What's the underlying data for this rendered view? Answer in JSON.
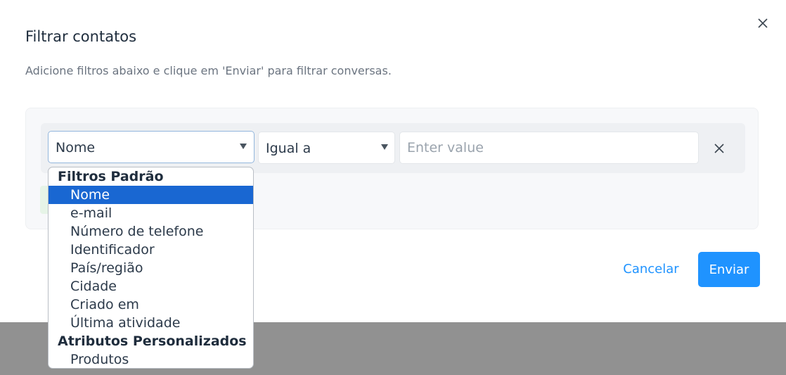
{
  "modal": {
    "title": "Filtrar contatos",
    "subtitle": "Adicione filtros abaixo e clique em 'Enviar' para filtrar conversas.",
    "close_icon": "close-icon"
  },
  "filter": {
    "attribute_value": "Nome",
    "operator_value": "Igual a",
    "value_placeholder": "Enter value",
    "remove_icon": "close-icon"
  },
  "dropdown": {
    "groups": [
      {
        "label": "Filtros Padrão",
        "options": [
          "Nome",
          "e-mail",
          "Número de telefone",
          "Identificador",
          "País/região",
          "Cidade",
          "Criado em",
          "Última atividade"
        ]
      },
      {
        "label": "Atributos Personalizados",
        "options": [
          "Produtos"
        ]
      }
    ],
    "selected": "Nome"
  },
  "footer": {
    "cancel_label": "Cancelar",
    "submit_label": "Enviar"
  },
  "colors": {
    "accent": "#1f93ff",
    "selected_option": "#1967d2",
    "backdrop": "#919191"
  }
}
